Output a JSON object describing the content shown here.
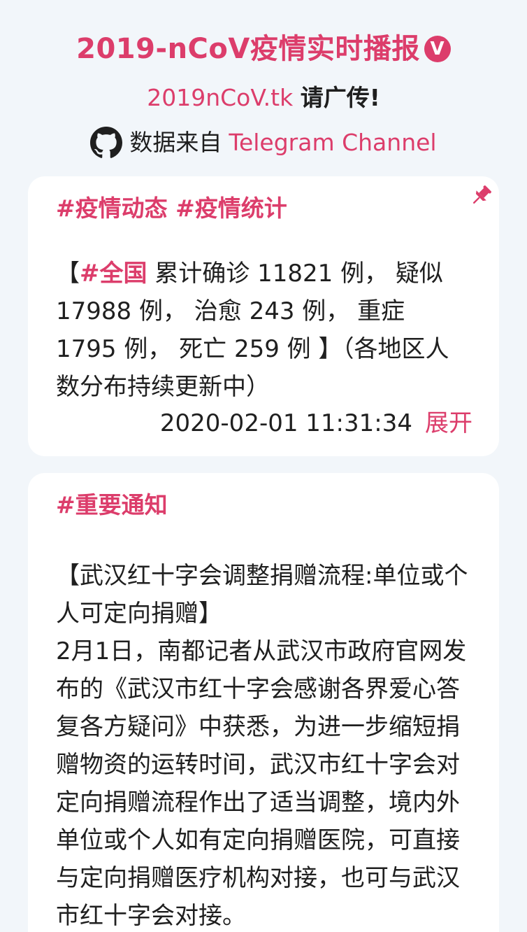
{
  "header": {
    "title": "2019-nCoV疫情实时播报",
    "verified_mark": "V",
    "site_link": "2019nCoV.tk",
    "share_text": "请广传!",
    "source_prefix": "数据来自",
    "source_link": "Telegram Channel"
  },
  "posts": [
    {
      "tags": "#疫情动态 #疫情统计",
      "bracket_open": "【",
      "region_tag": "#全国",
      "stats_text": "  累计确诊 11821 例， 疑似 17988 例， 治愈 243 例， 重症 1795 例， 死亡 259 例 】（各地区人数分布持续更新中）",
      "timestamp": "2020-02-01 11:31:34",
      "expand_label": "展开",
      "pinned": true
    },
    {
      "tags": "#重要通知",
      "headline": "【武汉红十字会调整捐赠流程:单位或个人可定向捐赠】",
      "body": "2月1日，南都记者从武汉市政府官网发布的《武汉市红十字会感谢各界爱心答复各方疑问》中获悉，为进一步缩短捐赠物资的运转时间，武汉市红十字会对定向捐赠流程作出了适当调整，境内外单位或个人如有定向捐赠医院，可直接与定向捐赠医疗机构对接，也可与武汉市红十字会对接。"
    }
  ],
  "colors": {
    "accent": "#dc3d6b",
    "background": "#f2f6fa",
    "card": "#ffffff",
    "text": "#1f1f1f"
  },
  "icons": {
    "verified": "verified-badge-icon",
    "github": "github-icon",
    "pin": "pin-icon"
  }
}
